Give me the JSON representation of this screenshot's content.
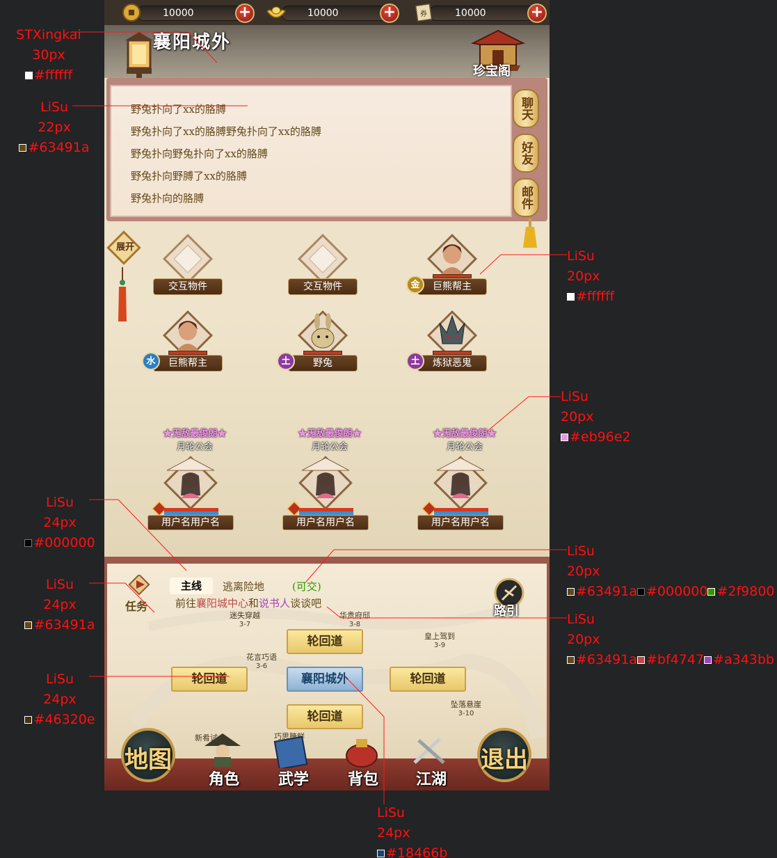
{
  "resources": [
    {
      "icon": "coin-icon",
      "value": "10000"
    },
    {
      "icon": "gold-ingot-icon",
      "value": "10000"
    },
    {
      "icon": "scroll-icon",
      "value": "10000"
    }
  ],
  "location": {
    "title": "襄阳城外"
  },
  "treasure": {
    "label": "珍宝阁"
  },
  "chat": {
    "lines": [
      "野兔扑向了xx的胳膊",
      "野兔扑向了xx的胳膊野兔扑向了xx的胳膊",
      "野兔扑向野兔扑向了xx的胳膊",
      "野兔扑向野膊了xx的胳膊",
      "野兔扑向的胳膊"
    ],
    "tabs": [
      "聊天",
      "好友",
      "邮件"
    ]
  },
  "expand": {
    "label": "展开"
  },
  "entities": [
    {
      "name": "交互物件",
      "badge": "",
      "kind": "object"
    },
    {
      "name": "交互物件",
      "badge": "",
      "kind": "object"
    },
    {
      "name": "巨熊帮主",
      "badge": "金",
      "badge_color": "#b88a18",
      "kind": "npc"
    },
    {
      "name": "巨熊帮主",
      "badge": "水",
      "badge_color": "#2c7fc0",
      "kind": "npc"
    },
    {
      "name": "野兔",
      "badge": "土",
      "badge_color": "#8b3aa0",
      "kind": "rabbit"
    },
    {
      "name": "炼狱恶鬼",
      "badge": "土",
      "badge_color": "#8b3aa0",
      "kind": "demon"
    }
  ],
  "players": [
    {
      "title": "★无敌最俊朗★",
      "guild": "月轮公会",
      "name": "用户名用户名"
    },
    {
      "title": "★无敌最俊朗★",
      "guild": "月轮公会",
      "name": "用户名用户名"
    },
    {
      "title": "★无敌最俊朗★",
      "guild": "月轮公会",
      "name": "用户名用户名"
    }
  ],
  "task": {
    "label": "任务",
    "tab_main": "主线",
    "tab_escape": "逃离险地",
    "tab_status": "(可交)",
    "desc_prefix": "前往",
    "desc_place": "襄阳城中心",
    "desc_and": "和",
    "desc_person": "说书人",
    "desc_suffix": "谈谈吧",
    "guide_label": "路引"
  },
  "map": {
    "nodes": {
      "north": "轮回道",
      "west": "轮回道",
      "center": "襄阳城外",
      "east": "轮回道",
      "south": "轮回道"
    },
    "pois": [
      {
        "name": "迷失穿越",
        "level": "3-7"
      },
      {
        "name": "华贵府邸",
        "level": "3-8"
      },
      {
        "name": "皇上驾到",
        "level": "3-9"
      },
      {
        "name": "花言巧语",
        "level": "3-6"
      },
      {
        "name": "坠落悬崖",
        "level": "3-10"
      },
      {
        "name": "新肴试食",
        "level": ""
      },
      {
        "name": "巧思腌鲜",
        "level": ""
      }
    ]
  },
  "nav": {
    "map": "地图",
    "role": "角色",
    "martial": "武学",
    "bag": "背包",
    "jianghu": "江湖",
    "exit": "退出"
  },
  "annotations": [
    {
      "font": "STXingkai",
      "size": "30px",
      "colors": [
        "#ffffff"
      ]
    },
    {
      "font": "LiSu",
      "size": "22px",
      "colors": [
        "#63491a"
      ]
    },
    {
      "font": "LiSu",
      "size": "20px",
      "colors": [
        "#ffffff"
      ]
    },
    {
      "font": "LiSu",
      "size": "20px",
      "colors": [
        "#eb96e2"
      ]
    },
    {
      "font": "LiSu",
      "size": "24px",
      "colors": [
        "#000000"
      ]
    },
    {
      "font": "LiSu",
      "size": "20px",
      "colors": [
        "#63491a",
        "#000000",
        "#2f9800"
      ]
    },
    {
      "font": "LiSu",
      "size": "24px",
      "colors": [
        "#63491a"
      ]
    },
    {
      "font": "LiSu",
      "size": "20px",
      "colors": [
        "#63491a",
        "#bf4747",
        "#a343bb"
      ]
    },
    {
      "font": "LiSu",
      "size": "24px",
      "colors": [
        "#46320e"
      ]
    },
    {
      "font": "LiSu",
      "size": "24px",
      "colors": [
        "#18466b"
      ]
    }
  ]
}
